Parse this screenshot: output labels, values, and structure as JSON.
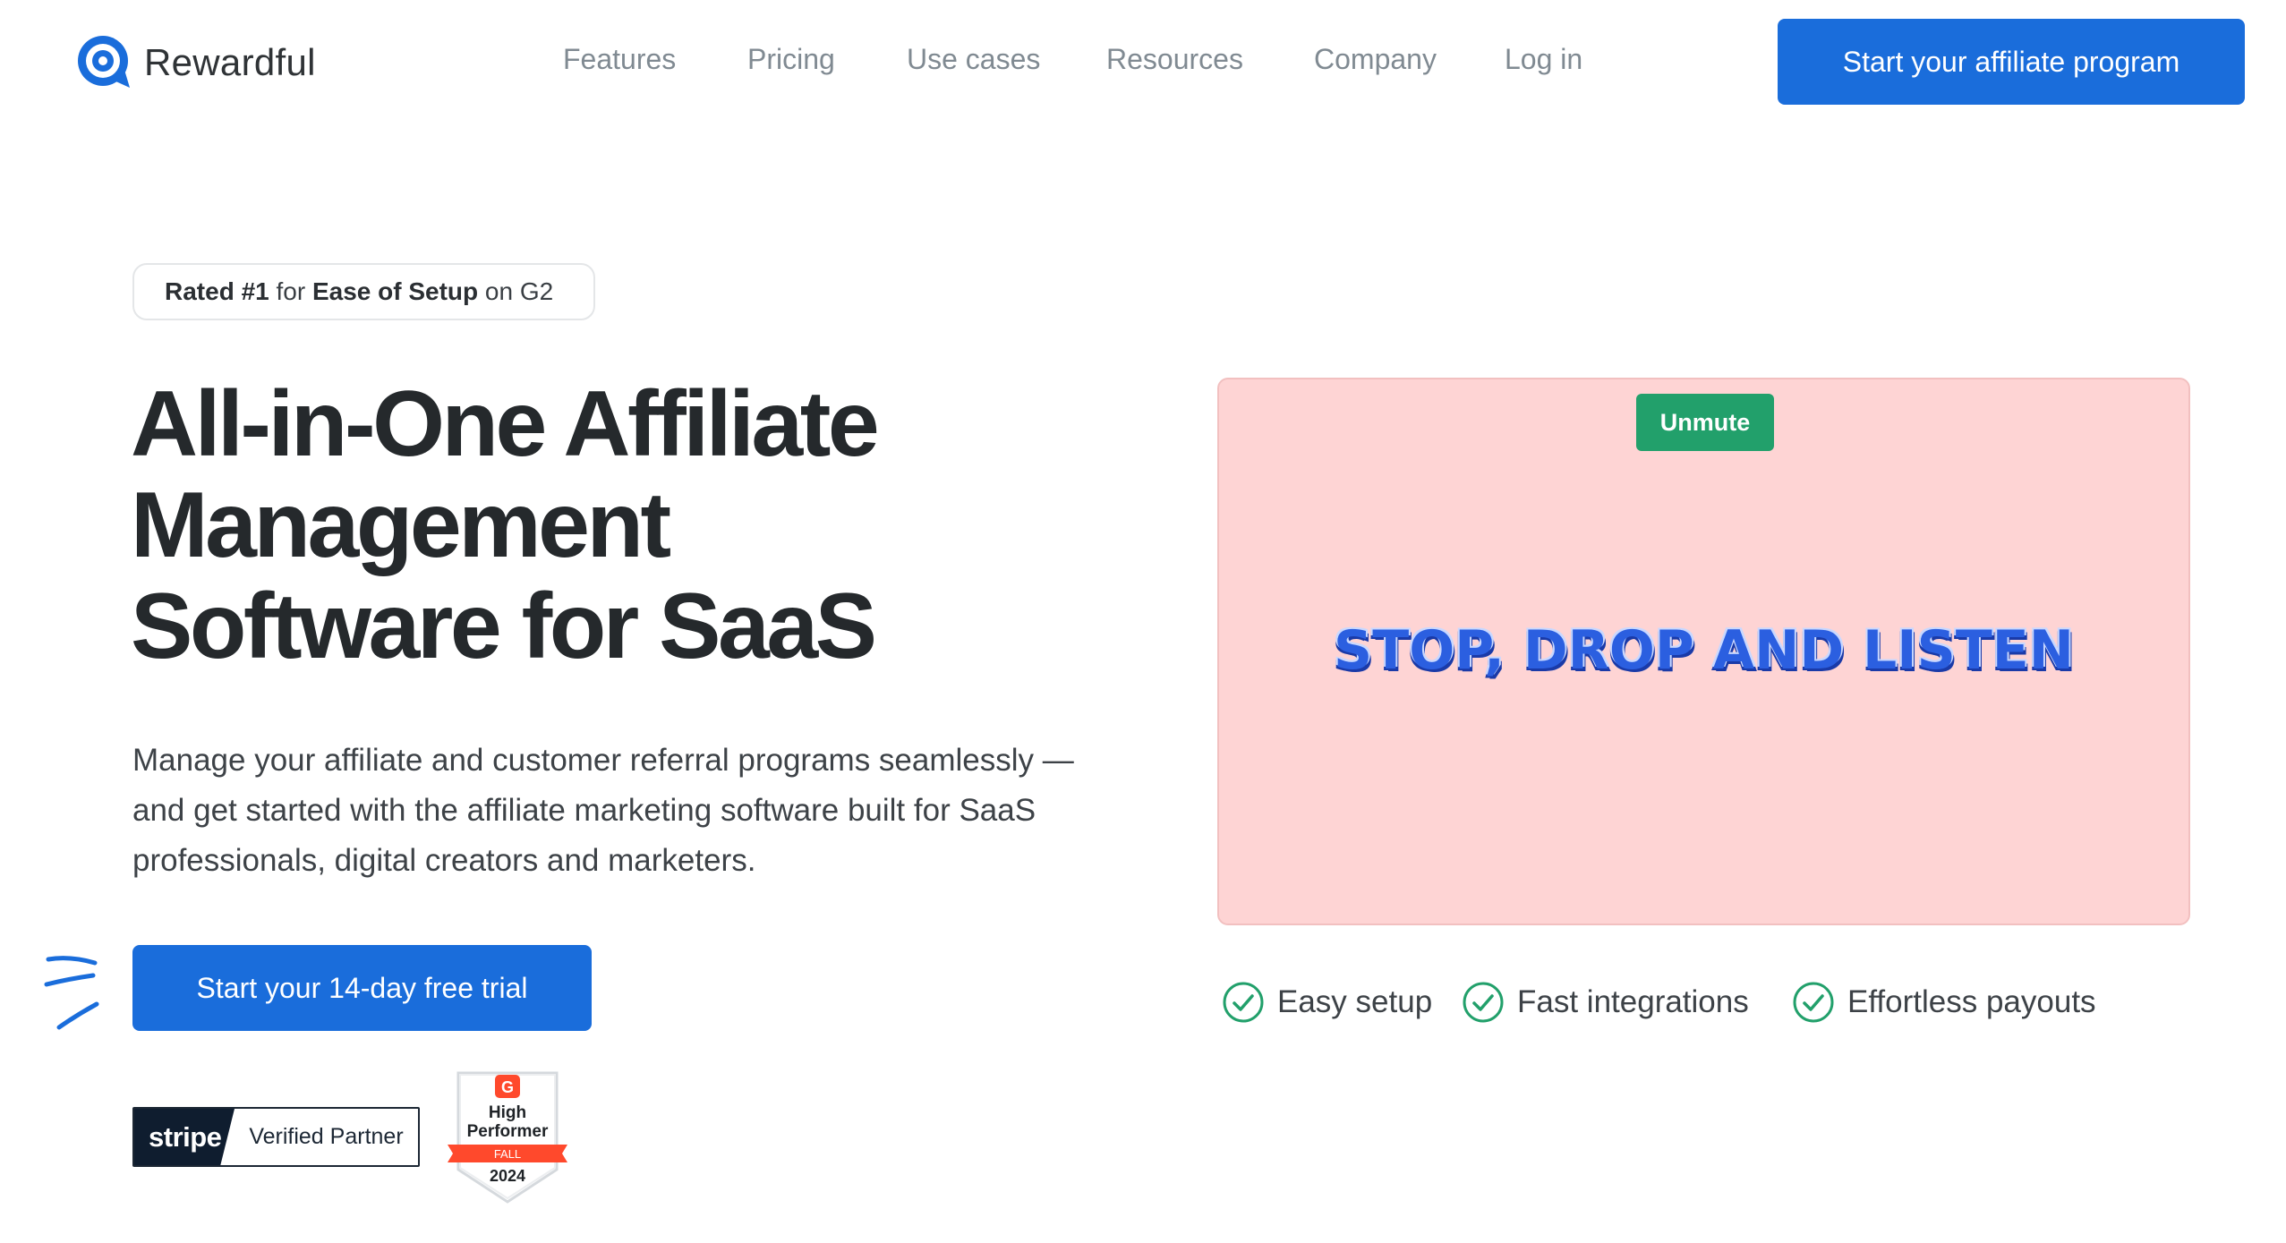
{
  "header": {
    "brand": "Rewardful",
    "nav": [
      {
        "label": "Features"
      },
      {
        "label": "Pricing"
      },
      {
        "label": "Use cases"
      },
      {
        "label": "Resources"
      },
      {
        "label": "Company"
      },
      {
        "label": "Log in"
      }
    ],
    "cta_label": "Start your affiliate program"
  },
  "hero": {
    "rating": {
      "part1": "Rated #1",
      "part2": " for ",
      "part3": "Ease of Setup",
      "part4": " on G2"
    },
    "headline": {
      "line1": "All-in-One Affiliate",
      "line2": "Management",
      "line3": "Software for SaaS"
    },
    "subtext": "Manage your affiliate and customer referral programs seamlessly — and get started with the affiliate marketing software built for SaaS professionals, digital creators and marketers.",
    "cta_label": "Start your 14-day free trial",
    "badges": {
      "stripe_logo": "stripe",
      "stripe_label": "Verified Partner",
      "g2_title_line1": "High",
      "g2_title_line2": "Performer",
      "g2_season": "FALL",
      "g2_year": "2024"
    }
  },
  "video": {
    "unmute_label": "Unmute",
    "title": "STOP, DROP AND LISTEN"
  },
  "features": [
    {
      "label": "Easy setup",
      "icon": "check-circle-icon"
    },
    {
      "label": "Fast integrations",
      "icon": "check-circle-icon"
    },
    {
      "label": "Effortless payouts",
      "icon": "check-circle-icon"
    }
  ],
  "colors": {
    "primary": "#1a6ddb",
    "success": "#22a06b",
    "video_bg": "#fed4d4",
    "check": "#22a06b"
  }
}
